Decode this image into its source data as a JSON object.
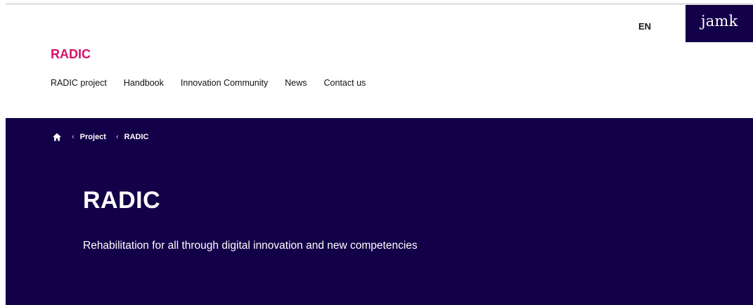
{
  "header": {
    "language": "EN",
    "logo_text": "jamk",
    "site_title": "RADIC"
  },
  "nav": {
    "items": [
      {
        "label": "RADIC project"
      },
      {
        "label": "Handbook"
      },
      {
        "label": "Innovation Community"
      },
      {
        "label": "News"
      },
      {
        "label": "Contact us"
      }
    ]
  },
  "breadcrumb": {
    "home_icon": "home-icon",
    "separator_icon": "chevron-left-icon",
    "items": [
      {
        "label": "Project"
      },
      {
        "label": "RADIC"
      }
    ]
  },
  "hero": {
    "title": "RADIC",
    "subtitle": "Rehabilitation for all through digital innovation and new competencies"
  },
  "colors": {
    "brand_navy": "#120048",
    "brand_magenta": "#d6116a",
    "divider": "#e3e3e3"
  }
}
